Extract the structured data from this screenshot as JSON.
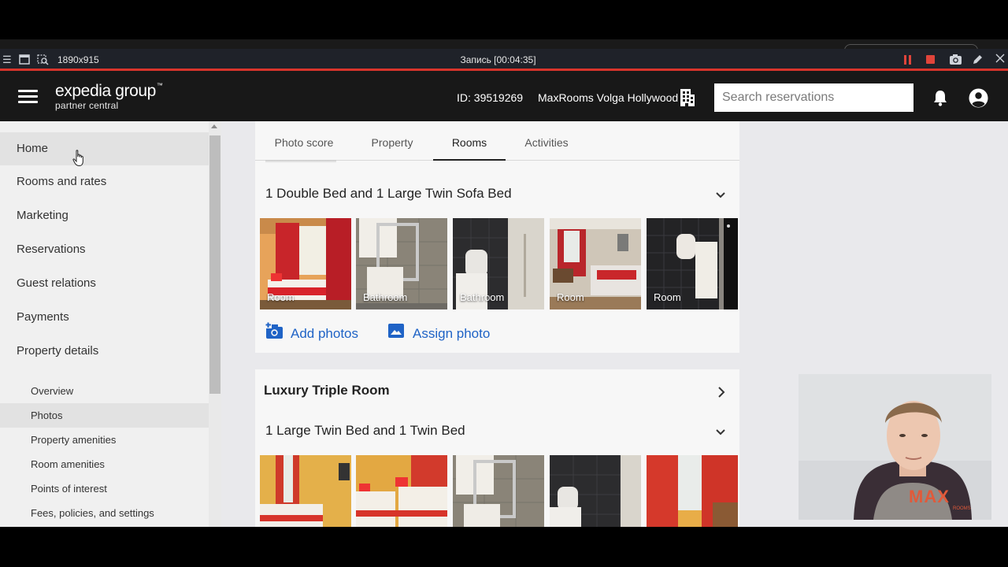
{
  "recorder": {
    "dims": "1890x915",
    "title": "Запись [00:04:35]"
  },
  "header": {
    "logo_main": "expedia group",
    "logo_tm": "™",
    "logo_sub": "partner central",
    "id_text": "ID: 39519269",
    "property_name": "MaxRooms Volga Hollywood",
    "search_placeholder": "Search reservations"
  },
  "sidebar": {
    "items": [
      {
        "label": "Home"
      },
      {
        "label": "Rooms and rates"
      },
      {
        "label": "Marketing"
      },
      {
        "label": "Reservations"
      },
      {
        "label": "Guest relations"
      },
      {
        "label": "Payments"
      },
      {
        "label": "Property details"
      }
    ],
    "sub_items": [
      {
        "label": "Overview"
      },
      {
        "label": "Photos"
      },
      {
        "label": "Property amenities"
      },
      {
        "label": "Room amenities"
      },
      {
        "label": "Points of interest"
      },
      {
        "label": "Fees, policies, and settings"
      }
    ]
  },
  "tabs": [
    {
      "label": "Photo score"
    },
    {
      "label": "Property"
    },
    {
      "label": "Rooms"
    },
    {
      "label": "Activities"
    }
  ],
  "room1": {
    "subtitle": "1 Double Bed and 1 Large Twin Sofa Bed",
    "photos": [
      {
        "label": "Room"
      },
      {
        "label": "Bathroom"
      },
      {
        "label": "Bathroom"
      },
      {
        "label": "Room"
      },
      {
        "label": "Room"
      }
    ],
    "add_photos": "Add photos",
    "assign_photo": "Assign photo"
  },
  "room2": {
    "title": "Luxury Triple Room",
    "subtitle": "1 Large Twin Bed and 1 Twin Bed"
  },
  "webcam": {
    "brand": "MAX",
    "brand_sub": "ROOMS"
  },
  "colors": {
    "header_bg": "#181818",
    "accent_red": "#d9342b",
    "link_blue": "#1f63c6"
  }
}
